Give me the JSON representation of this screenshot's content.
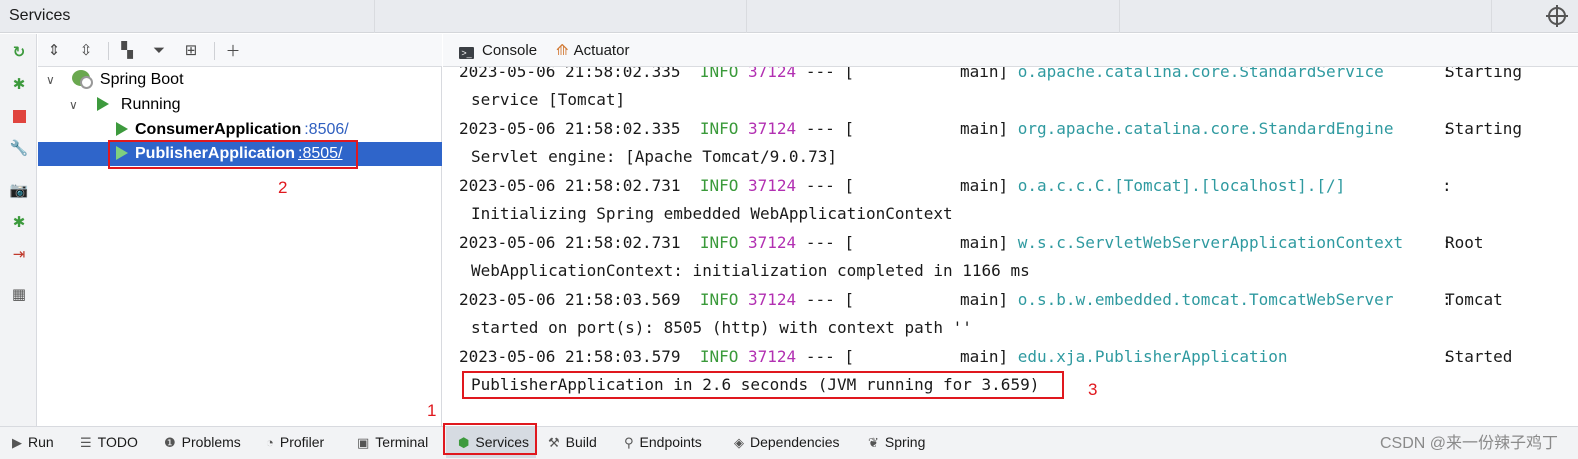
{
  "window": {
    "title": "Services"
  },
  "tree_toolbar": {
    "icons": [
      "expand-all-icon",
      "collapse-all-icon",
      "group-icon",
      "filter-icon",
      "new-tab-icon",
      "add-icon"
    ]
  },
  "tree": {
    "root": {
      "label": "Spring Boot"
    },
    "group": {
      "label": "Running"
    },
    "apps": [
      {
        "name": "ConsumerApplication",
        "port": ":8506/"
      },
      {
        "name": "PublisherApplication",
        "port": ":8505/"
      }
    ]
  },
  "console_tabs": {
    "console": "Console",
    "actuator": "Actuator"
  },
  "log": [
    {
      "ts": "2023-05-06 21:58:02.335",
      "level": "INFO",
      "pid": "37124",
      "sep": "---",
      "thread": "[           main]",
      "logger": "o.apache.catalina.core.StandardService",
      "colon": ":",
      "msg": "Starting",
      "cont": "service [Tomcat]"
    },
    {
      "ts": "2023-05-06 21:58:02.335",
      "level": "INFO",
      "pid": "37124",
      "sep": "---",
      "thread": "[           main]",
      "logger": "org.apache.catalina.core.StandardEngine",
      "colon": ":",
      "msg": "Starting",
      "cont": "Servlet engine: [Apache Tomcat/9.0.73]"
    },
    {
      "ts": "2023-05-06 21:58:02.731",
      "level": "INFO",
      "pid": "37124",
      "sep": "---",
      "thread": "[           main]",
      "logger": "o.a.c.c.C.[Tomcat].[localhost].[/]",
      "colon": ":",
      "msg": "",
      "cont": "Initializing Spring embedded WebApplicationContext"
    },
    {
      "ts": "2023-05-06 21:58:02.731",
      "level": "INFO",
      "pid": "37124",
      "sep": "---",
      "thread": "[           main]",
      "logger": "w.s.c.ServletWebServerApplicationContext",
      "colon": ":",
      "msg": "Root",
      "cont": "WebApplicationContext: initialization completed in 1166 ms"
    },
    {
      "ts": "2023-05-06 21:58:03.569",
      "level": "INFO",
      "pid": "37124",
      "sep": "---",
      "thread": "[           main]",
      "logger": "o.s.b.w.embedded.tomcat.TomcatWebServer",
      "colon": ":",
      "msg": "Tomcat",
      "cont": "started on port(s): 8505 (http) with context path ''"
    },
    {
      "ts": "2023-05-06 21:58:03.579",
      "level": "INFO",
      "pid": "37124",
      "sep": "---",
      "thread": "[           main]",
      "logger": "edu.xja.PublisherApplication",
      "colon": ":",
      "msg": "Started",
      "cont": "PublisherApplication in 2.6 seconds (JVM running for 3.659)"
    }
  ],
  "annotations": {
    "a1": "1",
    "a2": "2",
    "a3": "3"
  },
  "bottom_tabs": [
    {
      "label": "Run",
      "icon": "run-icon"
    },
    {
      "label": "TODO",
      "icon": "todo-icon"
    },
    {
      "label": "Problems",
      "icon": "problems-icon"
    },
    {
      "label": "Profiler",
      "icon": "profiler-icon"
    },
    {
      "label": "Terminal",
      "icon": "terminal-icon"
    },
    {
      "label": "Services",
      "icon": "services-icon"
    },
    {
      "label": "Build",
      "icon": "build-icon"
    },
    {
      "label": "Endpoints",
      "icon": "endpoints-icon"
    },
    {
      "label": "Dependencies",
      "icon": "dependencies-icon"
    },
    {
      "label": "Spring",
      "icon": "spring-icon"
    }
  ],
  "watermark": "CSDN @来一份辣子鸡丁",
  "colors": {
    "selection": "#2f65ca",
    "info": "#3a9a3a",
    "pid": "#b230b2",
    "logger": "#2f9aa0",
    "annotation": "#e0181e",
    "run_green": "#3d9a3d"
  }
}
